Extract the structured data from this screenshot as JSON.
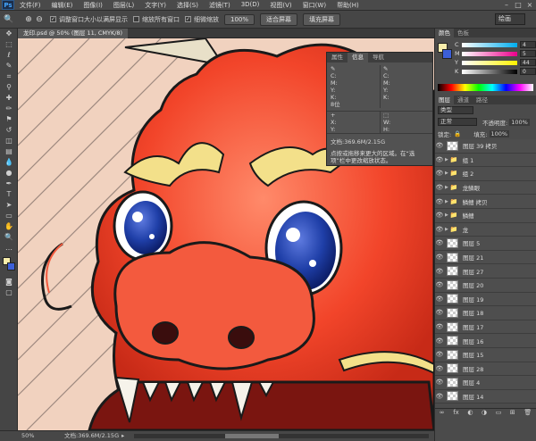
{
  "app": {
    "logo": "Ps"
  },
  "menu": [
    "文件(F)",
    "编辑(E)",
    "图像(I)",
    "图层(L)",
    "文字(Y)",
    "选择(S)",
    "滤镜(T)",
    "3D(D)",
    "视图(V)",
    "窗口(W)",
    "帮助(H)"
  ],
  "window_controls": {
    "minimize": "–",
    "maximize": "□",
    "close": "×"
  },
  "options": {
    "chk1": "调整窗口大小以满屏显示",
    "chk2": "缩放所有窗口",
    "chk3": "细微缩放",
    "btn_100": "100%",
    "btn_fit": "适合屏幕",
    "btn_fill": "填充屏幕",
    "workspace": "绘画"
  },
  "document": {
    "tab": "龙印.psd @ 50% (图层 11, CMYK/8)",
    "zoom": "50%",
    "doc_size": "文档:369.6M/2.15G"
  },
  "info_panel": {
    "tabs": [
      "属性",
      "信息",
      "导航"
    ],
    "fields": [
      "C:",
      "M:",
      "Y:",
      "K:",
      "8位"
    ],
    "fields2": [
      "C:",
      "M:",
      "Y:",
      "K:"
    ],
    "xy1": [
      "X:",
      "Y:"
    ],
    "wh": [
      "W:",
      "H:"
    ],
    "doc_size": "文档:369.6M/2.15G",
    "hint": "点按或拖移来更大的区域。在“选项”栏中更改缩放状态。"
  },
  "color_panel": {
    "tabs": [
      "颜色",
      "色板"
    ],
    "rows": [
      {
        "label": "C",
        "value": "4"
      },
      {
        "label": "M",
        "value": "5"
      },
      {
        "label": "Y",
        "value": "44"
      },
      {
        "label": "K",
        "value": "0"
      }
    ]
  },
  "layers_panel": {
    "tabs": [
      "图层",
      "通道",
      "路径"
    ],
    "filter": "类型",
    "mode": "正常",
    "opacity_label": "不透明度:",
    "opacity": "100%",
    "lock_label": "锁定:",
    "fill_label": "填充:",
    "fill": "100%",
    "layers": [
      {
        "name": "图层 39 拷贝",
        "type": "layer"
      },
      {
        "name": "组 1",
        "type": "group"
      },
      {
        "name": "组 2",
        "type": "group"
      },
      {
        "name": "龙鳞眼",
        "type": "group"
      },
      {
        "name": "鳞鳍 拷贝",
        "type": "group"
      },
      {
        "name": "鳞鳍",
        "type": "group"
      },
      {
        "name": "龙",
        "type": "group"
      },
      {
        "name": "图层 5",
        "type": "layer"
      },
      {
        "name": "图层 21",
        "type": "layer"
      },
      {
        "name": "图层 27",
        "type": "layer"
      },
      {
        "name": "图层 20",
        "type": "layer"
      },
      {
        "name": "图层 19",
        "type": "layer"
      },
      {
        "name": "图层 18",
        "type": "layer"
      },
      {
        "name": "图层 17",
        "type": "layer"
      },
      {
        "name": "图层 16",
        "type": "layer"
      },
      {
        "name": "图层 15",
        "type": "layer"
      },
      {
        "name": "图层 28",
        "type": "layer"
      },
      {
        "name": "图层 4",
        "type": "layer"
      },
      {
        "name": "图层 14",
        "type": "layer"
      }
    ]
  }
}
